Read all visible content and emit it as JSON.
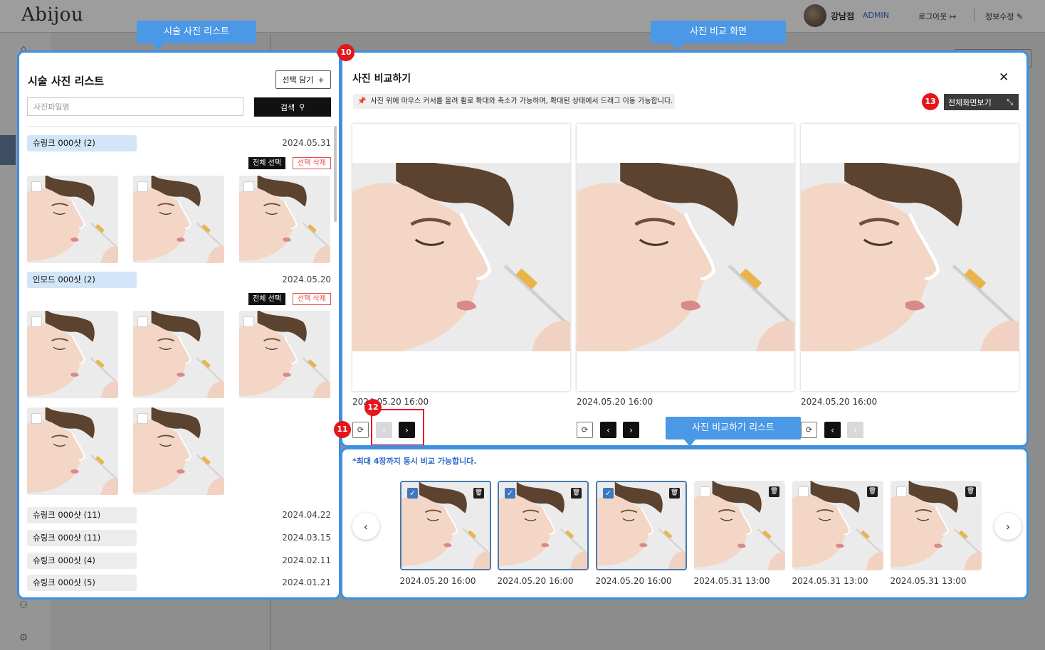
{
  "header": {
    "logo": "Abijou",
    "user_name": "강남점",
    "user_role": "ADMIN",
    "logout": "로그아웃 ↦",
    "profile_edit": "정보수정 ✎"
  },
  "callouts": {
    "photo_list": "시술 사진 리스트",
    "compare_screen": "사진 비교 화면",
    "compare_list": "사진 비교하기 리스트"
  },
  "markers": {
    "m10": "10",
    "m11": "11",
    "m12": "12",
    "m13": "13"
  },
  "photo_list": {
    "title": "시술 사진 리스트",
    "add_selected": "선택 담기",
    "search_placeholder": "사진파일명",
    "search_button": "검색",
    "select_all": "전체 선택",
    "delete_selected": "선택 삭제",
    "groups": [
      {
        "label": "슈링크 000샷 (2)",
        "date": "2024.05.31"
      },
      {
        "label": "인모드 000샷 (2)",
        "date": "2024.05.20"
      },
      {
        "label": "슈링크 000샷 (11)",
        "date": "2024.04.22"
      },
      {
        "label": "슈링크 000샷 (11)",
        "date": "2024.03.15"
      },
      {
        "label": "슈링크 000샷 (4)",
        "date": "2024.02.11"
      },
      {
        "label": "슈링크 000샷 (5)",
        "date": "2024.01.21"
      }
    ]
  },
  "compare": {
    "title": "사진 비교하기",
    "close": "✕",
    "notice": "사진 위에 마우스 커서를 올려 휠로 확대와 축소가 가능하며, 확대된 상태에서 드래그 이동 가능합니다.",
    "fullscreen": "전체화면보기",
    "viewers": [
      {
        "date": "2024.05.20 16:00"
      },
      {
        "date": "2024.05.20 16:00"
      },
      {
        "date": "2024.05.20 16:00"
      }
    ]
  },
  "compare_list": {
    "note": "*최대 4장까지 동시 비교 가능합니다.",
    "items": [
      {
        "date": "2024.05.20 16:00",
        "selected": true
      },
      {
        "date": "2024.05.20 16:00",
        "selected": true
      },
      {
        "date": "2024.05.20 16:00",
        "selected": true
      },
      {
        "date": "2024.05.31 13:00",
        "selected": false
      },
      {
        "date": "2024.05.31 13:00",
        "selected": false
      },
      {
        "date": "2024.05.31 13:00",
        "selected": false
      }
    ]
  },
  "colors": {
    "accent": "#3e8fe0",
    "marker": "#e5151b",
    "tag_active": "#d2e6f8"
  },
  "icons": {
    "search": "search-icon",
    "plus": "plus-icon",
    "close": "close-icon",
    "expand": "expand-icon",
    "reset": "reset-icon",
    "prev": "chevron-left-icon",
    "next": "chevron-right-icon",
    "trash": "trash-icon",
    "check": "check-icon",
    "pin": "pin-icon"
  }
}
